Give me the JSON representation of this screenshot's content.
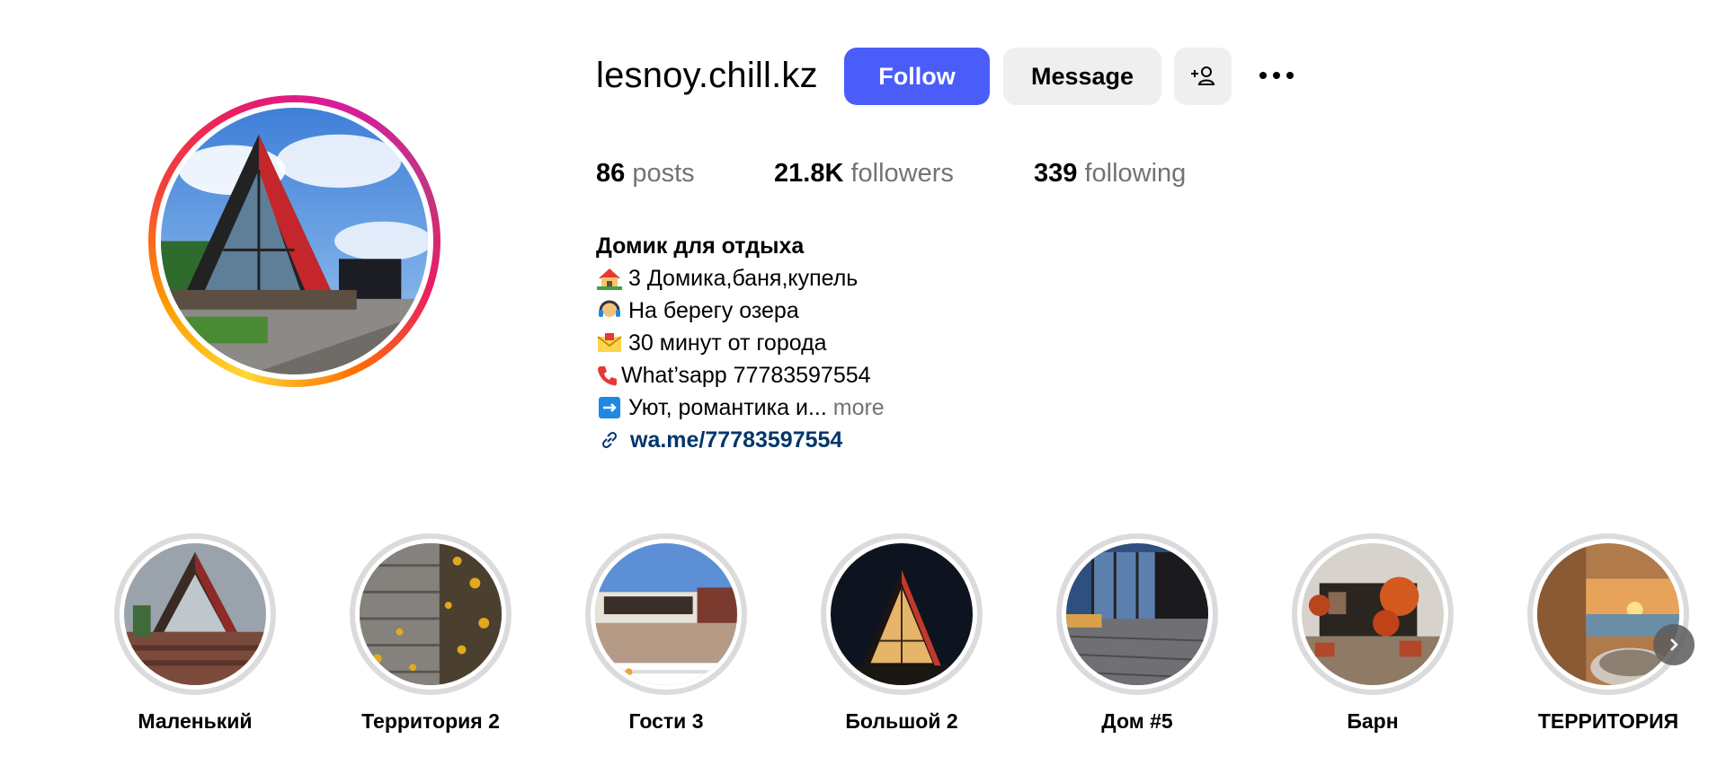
{
  "profile": {
    "username": "lesnoy.chill.kz",
    "follow_label": "Follow",
    "message_label": "Message",
    "stats": {
      "posts_count": "86",
      "posts_label": "posts",
      "followers_count": "21.8K",
      "followers_label": "followers",
      "following_count": "339",
      "following_label": "following"
    },
    "bio": {
      "name": "Домик для отдыха",
      "lines": [
        {
          "icon": "house-emoji-icon",
          "text": "3 Домика,баня,купель"
        },
        {
          "icon": "headset-emoji-icon",
          "text": "На берегу озера"
        },
        {
          "icon": "envelope-emoji-icon",
          "text": "30 минут от города"
        },
        {
          "icon": "telephone-emoji-icon",
          "text": "What’sapp 77783597554"
        },
        {
          "icon": "right-arrow-emoji-icon",
          "text": "Уют, романтика и..."
        }
      ],
      "more_label": "more",
      "link": "wa.me/77783597554"
    }
  },
  "highlights": [
    {
      "label": "Маленький"
    },
    {
      "label": "Территория 2"
    },
    {
      "label": "Гости 3"
    },
    {
      "label": "Большой 2"
    },
    {
      "label": "Дом #5"
    },
    {
      "label": "Барн"
    },
    {
      "label": "ТЕРРИТОРИЯ"
    }
  ],
  "colors": {
    "follow_button": "#4a5df9",
    "secondary_button": "#efefef",
    "link": "#00376b",
    "muted_text": "#737373"
  }
}
